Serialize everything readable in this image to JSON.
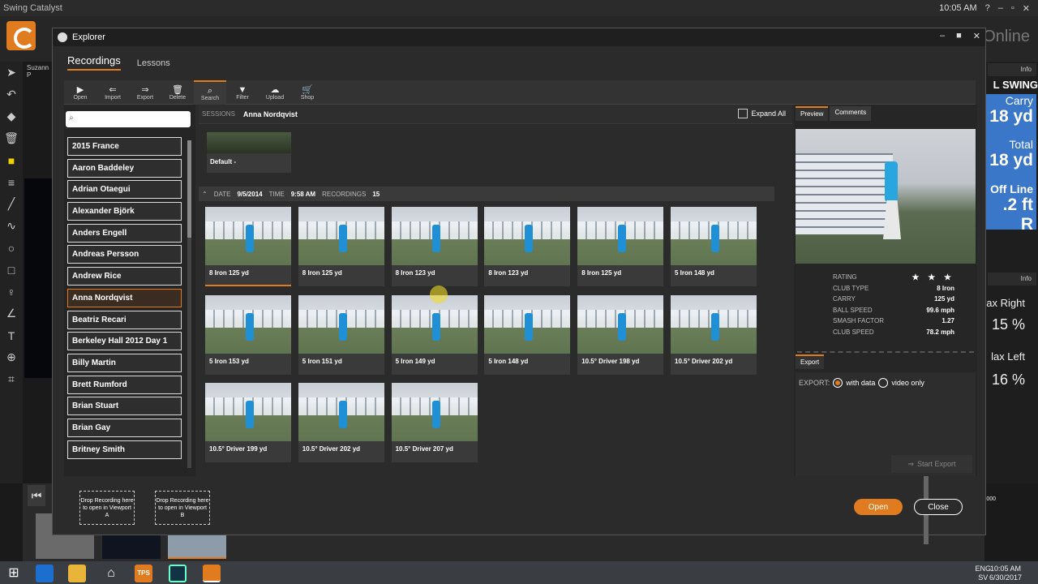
{
  "app": {
    "title": "Swing Catalyst",
    "online_text": "Online",
    "system_time": "10:05 AM",
    "player_label": "Suzann P"
  },
  "background_right": {
    "info_label": "Info",
    "section_title": "L SWING",
    "carry_label": "Carry",
    "carry_value": "18 yd",
    "total_label": "Total",
    "total_value": "18 yd",
    "offline_label": "Off Line",
    "offline_value": ".2 ft R",
    "info_label_2": "Info",
    "max_right_label": "ax Right",
    "max_right_value": "15 %",
    "max_left_label": "lax Left",
    "max_left_value": "16 %",
    "zoom": "000"
  },
  "taskbar": {
    "lang": "ENG",
    "lang_sub": "SV",
    "time": "10:05 AM",
    "date": "6/30/2017",
    "tps_label": "TPS"
  },
  "explorer": {
    "title": "Explorer",
    "tabs": [
      {
        "label": "Recordings",
        "active": true
      },
      {
        "label": "Lessons",
        "active": false
      }
    ],
    "toolbar": [
      {
        "label": "Open",
        "icon": "play-box-icon"
      },
      {
        "label": "Import",
        "icon": "import-icon"
      },
      {
        "label": "Export",
        "icon": "export-icon"
      },
      {
        "label": "Delete",
        "icon": "trash-icon"
      },
      {
        "label": "Search",
        "icon": "search-icon",
        "active": true
      },
      {
        "label": "Filter",
        "icon": "filter-icon"
      },
      {
        "label": "Upload",
        "icon": "upload-icon"
      },
      {
        "label": "Shop",
        "icon": "cart-icon"
      }
    ],
    "search": {
      "value": "",
      "placeholder": ""
    },
    "names": [
      "2015 France",
      "Aaron Baddeley",
      "Adrian Otaegui",
      "Alexander Björk",
      "Anders Engell",
      "Andreas Persson",
      "Andrew Rice",
      "Anna Nordqvist",
      "Beatriz Recari",
      "Berkeley Hall 2012 Day 1",
      "Billy Martin",
      "Brett Rumford",
      "Brian Stuart",
      "Brian Gay",
      "Britney Smith"
    ],
    "selected_name_index": 7,
    "crumb": {
      "label": "SESSIONS",
      "name": "Anna Nordqvist"
    },
    "expand_all_label": "Expand All",
    "default_card": {
      "label": "Default",
      "suffix": "-"
    },
    "session": {
      "date_label": "DATE",
      "date_value": "9/5/2014",
      "time_label": "TIME",
      "time_value": "9:58 AM",
      "recordings_label": "RECORDINGS",
      "recordings_value": "15"
    },
    "recordings": [
      "8 Iron 125 yd",
      "8 Iron 125 yd",
      "8 Iron 123 yd",
      "8 Iron 123 yd",
      "8 Iron 125 yd",
      "5 Iron 148 yd",
      "5 Iron 153 yd",
      "5 Iron 151 yd",
      "5 Iron 149 yd",
      "5 Iron 148 yd",
      "10.5° Driver 198 yd",
      "10.5° Driver 202 yd",
      "10.5° Driver 199 yd",
      "10.5° Driver 202 yd",
      "10.5° Driver 207 yd"
    ],
    "preview_tabs": [
      {
        "label": "Preview",
        "active": true
      },
      {
        "label": "Comments",
        "active": false
      }
    ],
    "stats": [
      {
        "label": "RATING",
        "value": "★ ★ ★"
      },
      {
        "label": "CLUB TYPE",
        "value": "8 Iron"
      },
      {
        "label": "CARRY",
        "value": "125 yd"
      },
      {
        "label": "BALL SPEED",
        "value": "99.6 mph"
      },
      {
        "label": "SMASH FACTOR",
        "value": "1.27"
      },
      {
        "label": "CLUB SPEED",
        "value": "78.2 mph"
      }
    ],
    "export": {
      "tab_label": "Export",
      "label": "EXPORT:",
      "option_with_data": "with data",
      "option_video_only": "video only",
      "start_label": "Start Export"
    },
    "drop_a": "Drop Recording here to open in Viewport A",
    "drop_b": "Drop Recording here to open in Viewport B",
    "open_button": "Open",
    "close_button": "Close"
  },
  "colors": {
    "accent": "#e07b1f",
    "stat_card": "#3b77c8"
  }
}
